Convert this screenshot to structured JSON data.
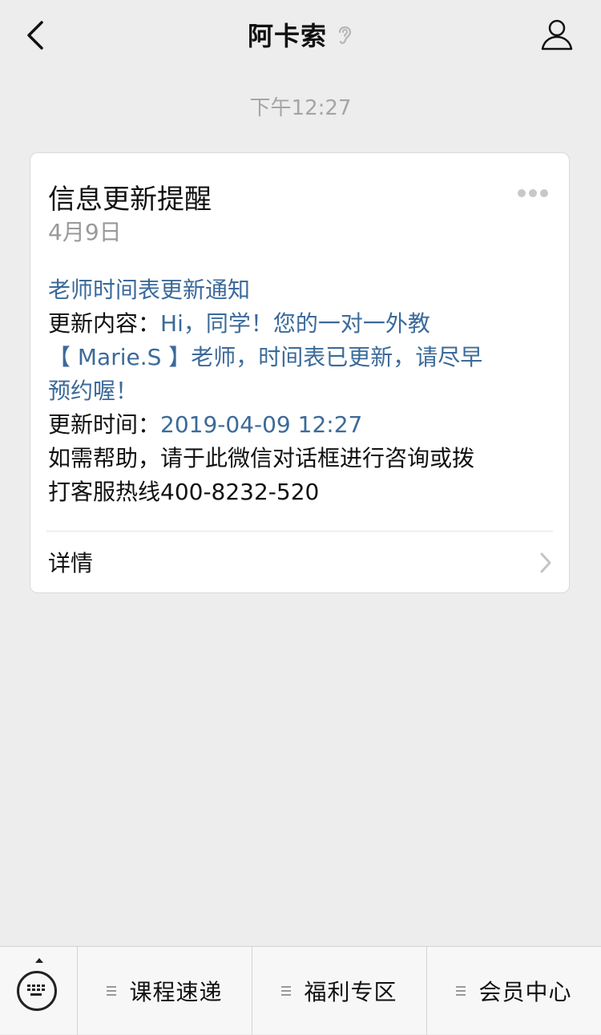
{
  "header": {
    "title": "阿卡索",
    "back_icon": "chevron-left-icon",
    "profile_icon": "user-icon",
    "title_icon": "ear-icon"
  },
  "timestamp": "下午12:27",
  "card": {
    "title": "信息更新提醒",
    "date": "4月9日",
    "notice_heading": "老师时间表更新通知",
    "content_label": "更新内容：",
    "content_line1": "Hi，同学！您的一对一外教",
    "content_line2": "【 Marie.S 】老师，时间表已更新，请尽早",
    "content_line3": "预约喔！",
    "time_label": "更新时间：",
    "time_value": "2019-04-09 12:27",
    "help_line1": "如需帮助，请于此微信对话框进行咨询或拨",
    "help_line2": "打客服热线400-8232-520",
    "detail_label": "详情"
  },
  "bottom_menu": {
    "keyboard_icon": "keyboard-icon",
    "items": [
      {
        "label": "课程速递"
      },
      {
        "label": "福利专区"
      },
      {
        "label": "会员中心"
      }
    ]
  },
  "colors": {
    "background": "#ededed",
    "link_blue": "#3b6a9a",
    "timestamp_gray": "#a5a5a5"
  }
}
